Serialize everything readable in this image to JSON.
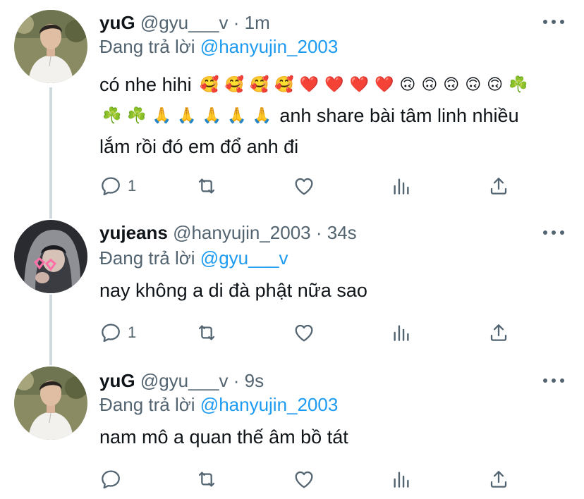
{
  "tweets": [
    {
      "name": "yuG",
      "handle": "@gyu___v",
      "sep": "·",
      "time": "1m",
      "reply_prefix": "Đang trả lời",
      "reply_to": "@hanyujin_2003",
      "text_line1_start": "có nhe hihi",
      "emoji_line1": [
        "🥰",
        "🥰",
        "🥰",
        "🥰",
        "❤️",
        "❤️",
        "❤️",
        "❤️",
        "🙃",
        "🙃",
        "🙃",
        "🙃",
        "🙃",
        "☘️"
      ],
      "emoji_line2": [
        "☘️",
        "☘️",
        "🙏",
        "🙏",
        "🙏",
        "🙏",
        "🙏"
      ],
      "text_line2_end": "anh share bài tâm linh nhiều",
      "text_line3": "lắm rồi đó em đổ anh đi",
      "reply_count": "1"
    },
    {
      "name": "yujeans",
      "handle": "@hanyujin_2003",
      "sep": "·",
      "time": "34s",
      "reply_prefix": "Đang trả lời",
      "reply_to": "@gyu___v",
      "text": "nay không a di đà phật nữa sao",
      "reply_count": "1"
    },
    {
      "name": "yuG",
      "handle": "@gyu___v",
      "sep": "·",
      "time": "9s",
      "reply_prefix": "Đang trả lời",
      "reply_to": "@hanyujin_2003",
      "text": "nam mô a quan thế âm bồ tát",
      "reply_count": ""
    }
  ],
  "colors": {
    "text": "#0f1419",
    "secondary": "#536471",
    "link": "#1d9bf0",
    "thread_line": "#cfd9de"
  },
  "icons": [
    "reply-icon",
    "retweet-icon",
    "like-icon",
    "analytics-icon",
    "share-icon",
    "more-icon"
  ]
}
